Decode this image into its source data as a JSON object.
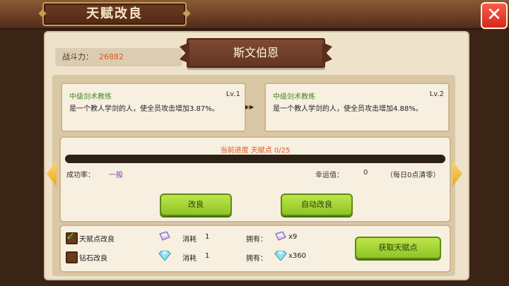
{
  "header": {
    "title": "天赋改良",
    "close_label": "✕"
  },
  "character": {
    "power_label": "战斗力：",
    "power_value": "26882",
    "name": "斯文伯恩"
  },
  "talent_current": {
    "name": "中级剑术教练",
    "level": "Lv.1",
    "description": "是一个教人学剑的人，使全员攻击增加3.87%。"
  },
  "talent_next": {
    "name": "中级剑术教练",
    "level": "Lv.2",
    "description": "是一个教人学剑的人，使全员攻击增加4.88%。"
  },
  "progress": {
    "label": "当前进度  天赋点  0/25",
    "current": 0,
    "max": 25
  },
  "stats": {
    "success_label": "成功率：",
    "success_value": "一般",
    "luck_label": "幸运值：",
    "luck_value": "0",
    "reset_note": "（每日0点清零）"
  },
  "buttons": {
    "improve": "改良",
    "auto_improve": "自动改良",
    "get_points": "获取天赋点"
  },
  "options": [
    {
      "label": "天赋点改良",
      "checked": true,
      "consume_label": "消耗",
      "consume_value": "1",
      "own_label": "拥有：",
      "own_value": "x9",
      "icon": "talent-crystal-icon"
    },
    {
      "label": "钻石改良",
      "checked": false,
      "consume_label": "消耗",
      "consume_value": "1",
      "own_label": "拥有：",
      "own_value": "x360",
      "icon": "diamond-icon"
    }
  ],
  "colors": {
    "accent_orange": "#e0561b",
    "talent_green": "#3e8a22",
    "button_green": "#8ec426"
  }
}
